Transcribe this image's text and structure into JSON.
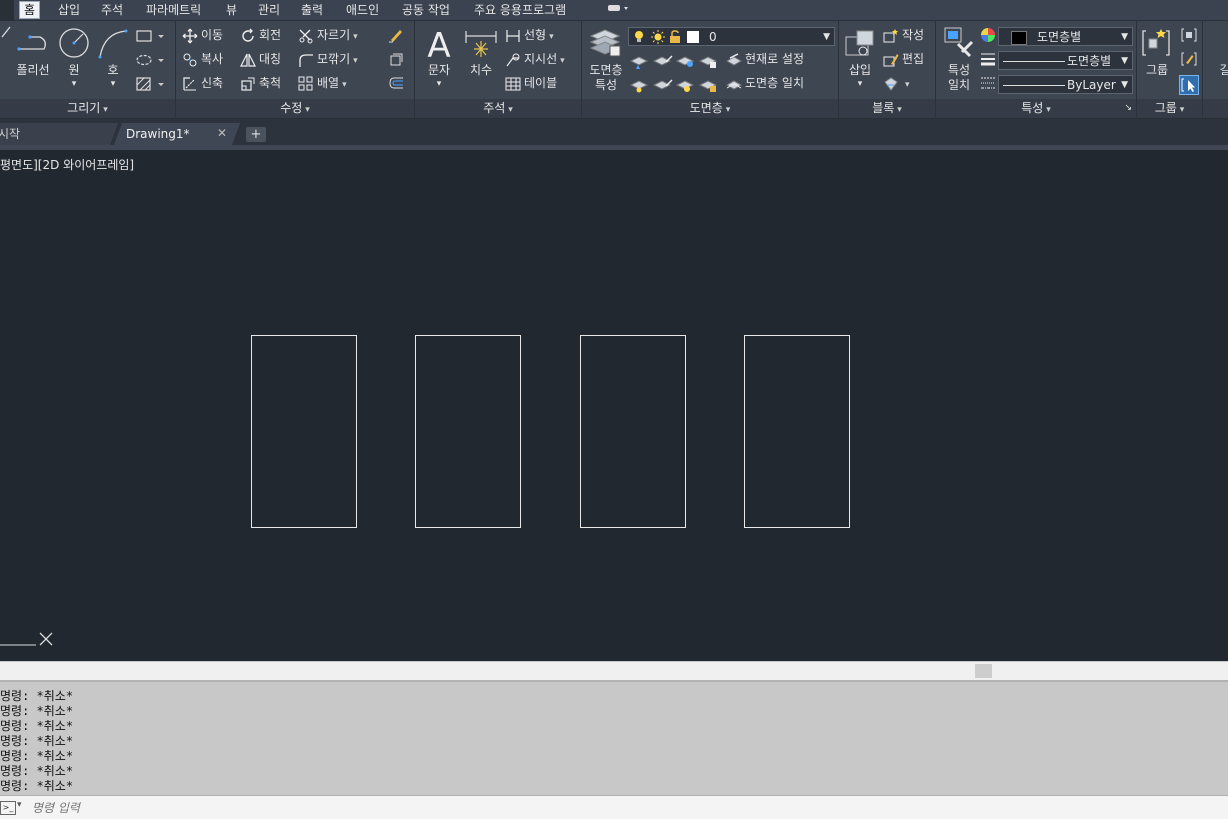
{
  "menu": {
    "tabs": [
      "홈",
      "삽입",
      "주석",
      "파라메트릭",
      "뷰",
      "관리",
      "출력",
      "애드인",
      "공동 작업",
      "주요 응용프로그램"
    ],
    "active": "홈"
  },
  "ribbon": {
    "draw": {
      "title": "그리기",
      "polyline": "폴리선",
      "circle": "원",
      "arc": "호"
    },
    "modify": {
      "title": "수정",
      "move": "이동",
      "rotate": "회전",
      "trim": "자르기",
      "copy": "복사",
      "mirror": "대칭",
      "fillet": "모깎기",
      "stretch": "신축",
      "scale": "축척",
      "array": "배열"
    },
    "annotation": {
      "title": "주석",
      "text": "문자",
      "dimension": "치수",
      "linear": "선형",
      "leader": "지시선",
      "table": "테이블"
    },
    "layers": {
      "title": "도면층",
      "layer_props_1": "도면층",
      "layer_props_2": "특성",
      "current_layer": "0",
      "make_current": "현재로 설정",
      "match_layer": "도면층 일치"
    },
    "block": {
      "title": "블록",
      "insert": "삽입",
      "create": "작성",
      "edit": "편집"
    },
    "properties": {
      "title": "특성",
      "match_1": "특성",
      "match_2": "일치",
      "color": "도면층별",
      "linetype": "도면층별",
      "lineweight": "ByLayer"
    },
    "groups": {
      "title": "그룹",
      "group": "그룹"
    },
    "extra": "길"
  },
  "tabs": {
    "start": "시작",
    "drawing": "Drawing1*",
    "add": "+"
  },
  "viewport": {
    "label": "평면도][2D 와이어프레임]"
  },
  "command": {
    "history": [
      "명령: *취소*",
      "명령: *취소*",
      "명령: *취소*",
      "명령: *취소*",
      "명령: *취소*",
      "명령: *취소*",
      "명령: *취소*"
    ],
    "placeholder": "명령 입력"
  },
  "colors": {
    "canvas": "#212830",
    "ribbon": "#3e4652",
    "shape_stroke": "#e8e8e8"
  }
}
